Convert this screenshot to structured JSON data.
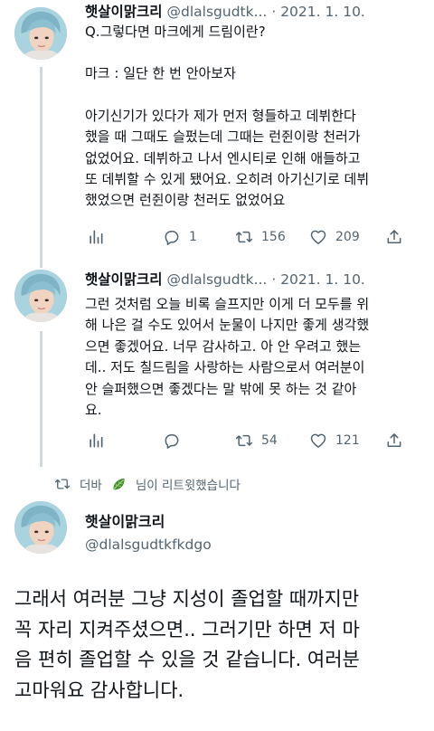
{
  "tweets": [
    {
      "name": "햇살이맑크리",
      "handle": "@dlalsgudtk...",
      "dot": "·",
      "date": "2021. 1. 10.",
      "paragraphs": [
        "Q.그렇다면 마크에게 드림이란?",
        "마크 : 일단 한 번 안아보자",
        "아기신기가 있다가 제가 먼저 형들하고 데뷔한다\n했을 때 그때도 슬펐는데 그때는 런쥔이랑 천러가\n없었어요. 데뷔하고 나서 엔시티로 인해 애들하고\n또 데뷔할 수 있게 됐어요. 오히려 아기신기로 데뷔\n했었으면 런쥔이랑 천러도 없었어요"
      ],
      "stats": {
        "replies": "1",
        "retweets": "156",
        "likes": "209"
      }
    },
    {
      "name": "햇살이맑크리",
      "handle": "@dlalsgudtk...",
      "dot": "·",
      "date": "2021. 1. 10.",
      "paragraphs": [
        "그런 것처럼 오늘 비록 슬프지만 이게 더 모두를 위\n해 나은 걸 수도 있어서 눈물이 나지만 좋게 생각했\n으면 좋겠어요. 너무 감사하고. 아 안 우려고 했는\n데.. 저도 칠드림을 사랑하는 사람으로서 여러분이\n안 슬퍼했으면 좋겠다는 말 밖에 못 하는 것 같아\n요."
      ],
      "stats": {
        "replies": "",
        "retweets": "54",
        "likes": "121"
      }
    }
  ],
  "retweet_banner": {
    "prefix": "더바",
    "emoji": "leafy-green-emoji",
    "suffix": "님이 리트윗했습니다"
  },
  "main_tweet": {
    "name": "햇살이맑크리",
    "handle": "@dlalsgudtkfkdgo",
    "text": "그래서 여러분 그냥 지성이 졸업할 때까지만\n꼭 자리 지켜주셨으면.. 그러기만 하면 저 마\n음 편히 졸업할 수 있을 것 같습니다. 여러분\n고마워요 감사합니다."
  },
  "colors": {
    "text": "#0f1419",
    "secondary": "#536471",
    "thread": "#cfd9de",
    "avatar_bg": "#9ec7d6"
  },
  "icons": [
    "analytics-icon",
    "reply-icon",
    "retweet-icon",
    "like-icon",
    "share-icon"
  ]
}
